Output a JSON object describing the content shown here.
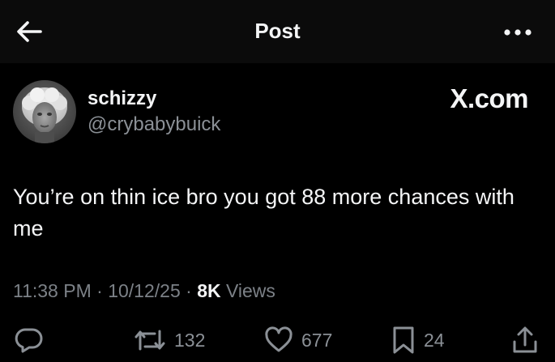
{
  "header": {
    "title": "Post"
  },
  "author": {
    "display_name": "schizzy",
    "handle": "@crybabybuick"
  },
  "watermark": "X.com",
  "post": {
    "text": "You’re on thin ice bro you got 88 more chances with me"
  },
  "meta": {
    "time": "11:38 PM",
    "separator": "·",
    "date": "10/12/25",
    "views_count": "8K",
    "views_label": "Views"
  },
  "actions": {
    "reposts": "132",
    "likes": "677",
    "bookmarks": "24"
  },
  "icons": {
    "back": "arrow-left-icon",
    "more": "more-dots-icon",
    "reply": "reply-icon",
    "repost": "repost-icon",
    "like": "heart-icon",
    "bookmark": "bookmark-icon",
    "share": "share-icon"
  },
  "colors": {
    "background": "#000000",
    "header_background": "#0b0b0b",
    "text_primary": "#f4f5f6",
    "text_secondary": "#8b9096"
  }
}
